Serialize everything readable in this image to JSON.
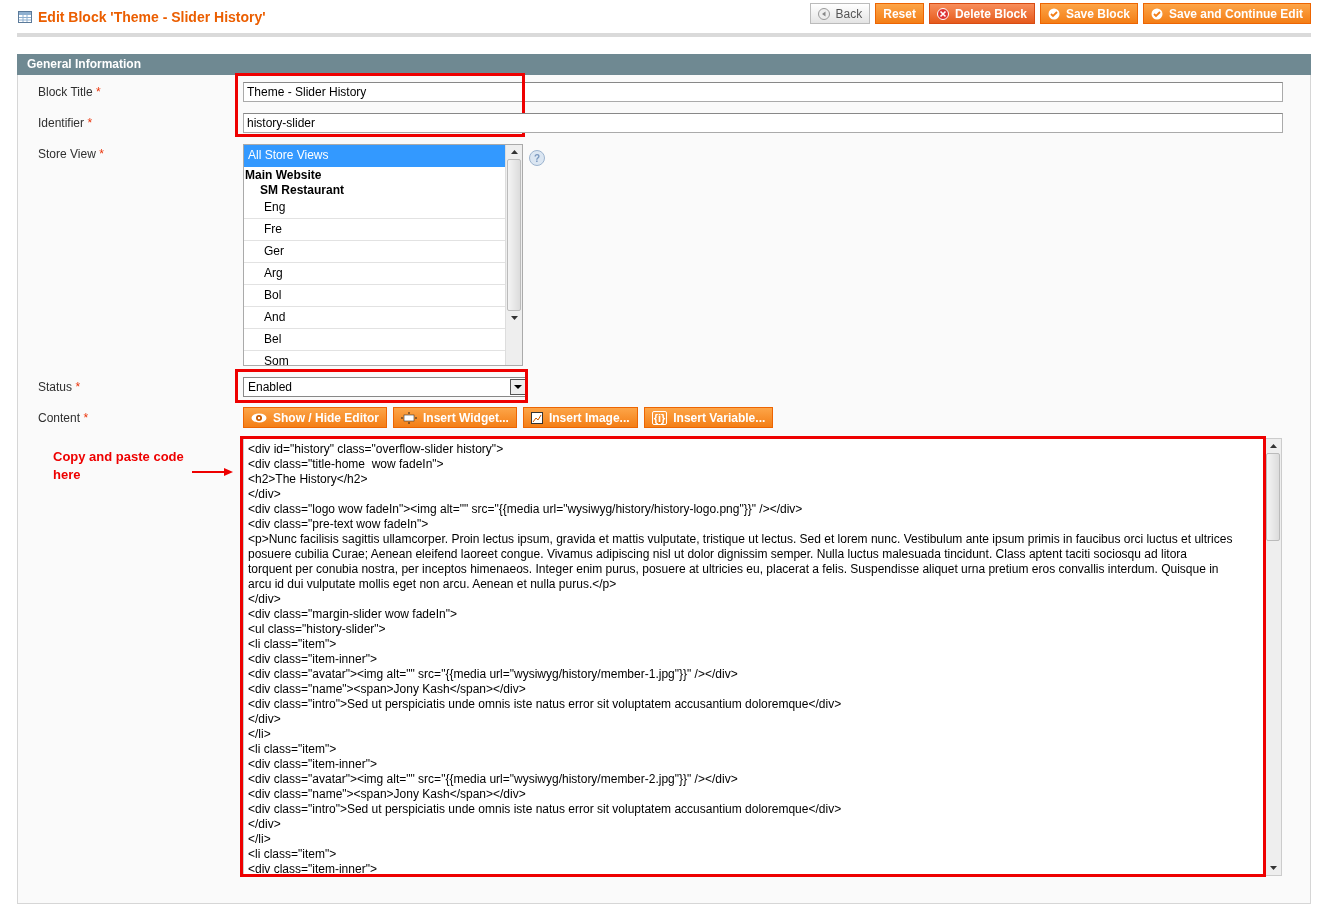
{
  "page": {
    "title": "Edit Block 'Theme - Slider History'"
  },
  "actions": [
    {
      "label": "Back",
      "kind": "back"
    },
    {
      "label": "Reset",
      "kind": "plain"
    },
    {
      "label": "Delete Block",
      "kind": "delete"
    },
    {
      "label": "Save Block",
      "kind": "save"
    },
    {
      "label": "Save and Continue Edit",
      "kind": "save"
    }
  ],
  "section": {
    "title": "General Information"
  },
  "fields": [
    {
      "kind": "text",
      "label": "Block Title",
      "required_mark": "*",
      "value": "Theme - Slider History",
      "highlighted": true
    },
    {
      "kind": "text",
      "label": "Identifier",
      "required_mark": "*",
      "value": "history-slider",
      "highlighted": true
    },
    {
      "kind": "multiselect",
      "label": "Store View",
      "required_mark": "*",
      "highlighted": false,
      "help": "?",
      "options": [
        {
          "label": "All Store Views",
          "selected": true
        },
        {
          "label": "Main Website",
          "children": [
            {
              "label": "SM Restaurant",
              "children": [
                {
                  "label": "Eng",
                  "selected": false
                },
                {
                  "label": "Fre",
                  "selected": false
                },
                {
                  "label": "Ger",
                  "selected": false
                },
                {
                  "label": "Arg",
                  "selected": false
                },
                {
                  "label": "Bol",
                  "selected": false
                },
                {
                  "label": "And",
                  "selected": false
                },
                {
                  "label": "Bel",
                  "selected": false
                },
                {
                  "label": "Som",
                  "selected": false
                }
              ]
            }
          ]
        }
      ]
    },
    {
      "kind": "select",
      "label": "Status",
      "required_mark": "*",
      "value": "Enabled",
      "highlighted": true
    },
    {
      "kind": "editor",
      "label": "Content",
      "required_mark": "*",
      "highlighted": true,
      "buttons": [
        {
          "label": "Show / Hide Editor",
          "kind": "toggle"
        },
        {
          "label": "Insert Widget...",
          "kind": "widget"
        },
        {
          "label": "Insert Image...",
          "kind": "image"
        },
        {
          "label": "Insert Variable...",
          "kind": "variable",
          "icon_text": "{i}"
        }
      ],
      "lines": [
        "<div id=\"history\" class=\"overflow-slider history\">",
        "<div class=\"title-home  wow fadeIn\">",
        "<h2>The History</h2>",
        "</div>",
        "<div class=\"logo wow fadeIn\"><img alt=\"\" src=\"{{media url=\"wysiwyg/history/history-logo.png\"}}\" /></div>",
        "<div class=\"pre-text wow fadeIn\">",
        "<p>Nunc facilisis sagittis ullamcorper. Proin lectus ipsum, gravida et mattis vulputate, tristique ut lectus. Sed et lorem nunc. Vestibulum ante ipsum primis in faucibus orci luctus et ultrices posuere cubilia Curae; Aenean eleifend laoreet congue. Vivamus adipiscing nisl ut dolor dignissim semper. Nulla luctus malesuada tincidunt. Class aptent taciti sociosqu ad litora torquent per conubia nostra, per inceptos himenaeos. Integer enim purus, posuere at ultricies eu, placerat a felis. Suspendisse aliquet urna pretium eros convallis interdum. Quisque in arcu id dui vulputate mollis eget non arcu. Aenean et nulla purus.</p>",
        "</div>",
        "<div class=\"margin-slider wow fadeIn\">",
        "<ul class=\"history-slider\">",
        "<li class=\"item\">",
        "<div class=\"item-inner\">",
        "<div class=\"avatar\"><img alt=\"\" src=\"{{media url=\"wysiwyg/history/member-1.jpg\"}}\" /></div>",
        "<div class=\"name\"><span>Jony Kash</span></div>",
        "<div class=\"intro\">Sed ut perspiciatis unde omnis iste natus error sit voluptatem accusantium doloremque</div>",
        "</div>",
        "</li>",
        "<li class=\"item\">",
        "<div class=\"item-inner\">",
        "<div class=\"avatar\"><img alt=\"\" src=\"{{media url=\"wysiwyg/history/member-2.jpg\"}}\" /></div>",
        "<div class=\"name\"><span>Jony Kash</span></div>",
        "<div class=\"intro\">Sed ut perspiciatis unde omnis iste natus error sit voluptatem accusantium doloremque</div>",
        "</div>",
        "</li>",
        "<li class=\"item\">",
        "<div class=\"item-inner\">"
      ]
    }
  ],
  "callout": {
    "text": "Copy and paste code here"
  }
}
